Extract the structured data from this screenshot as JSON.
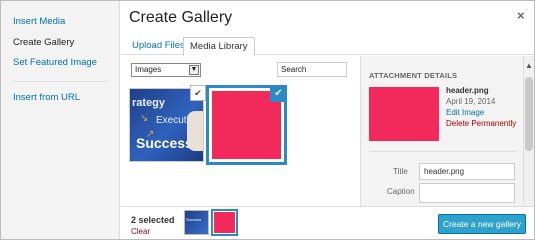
{
  "sidebar": {
    "items": [
      {
        "label": "Insert Media"
      },
      {
        "label": "Create Gallery"
      },
      {
        "label": "Set Featured Image"
      },
      {
        "label": "Insert from URL"
      }
    ]
  },
  "header": {
    "title": "Create Gallery",
    "close": "×"
  },
  "tabs": [
    {
      "label": "Upload Files"
    },
    {
      "label": "Media Library"
    }
  ],
  "toolbar": {
    "filter_value": "Images",
    "search_placeholder": "Search"
  },
  "grid": {
    "items": [
      {
        "name": "success-strategy-image",
        "text1": "rategy",
        "text2": "Executi",
        "text3": "Success",
        "checked": true
      },
      {
        "name": "header.png",
        "color": "#f22a5c",
        "checked": true
      }
    ]
  },
  "details": {
    "heading": "ATTACHMENT DETAILS",
    "filename": "header.png",
    "date": "April 19, 2014",
    "edit_link": "Edit Image",
    "delete_link": "Delete Permanently",
    "fields": {
      "title_label": "Title",
      "title_value": "header.png",
      "caption_label": "Caption"
    }
  },
  "footer": {
    "selected_count": "2 selected",
    "clear_label": "Clear",
    "create_button": "Create a new gallery"
  },
  "colors": {
    "accent": "#2ea2cc",
    "link": "#0073aa",
    "danger": "#a00000",
    "pink_image": "#f22a5c"
  }
}
